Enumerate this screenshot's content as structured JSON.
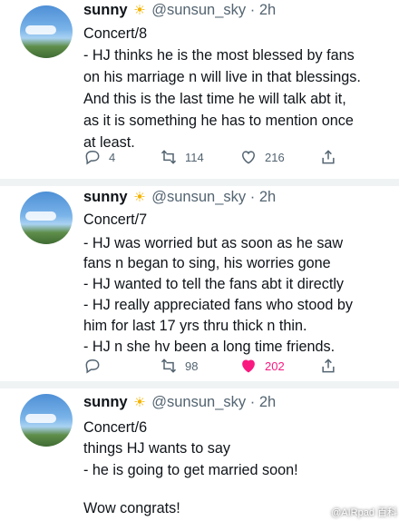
{
  "tweets": [
    {
      "name": "sunny",
      "handle": "@sunsun_sky",
      "time": "2h",
      "lines": [
        "Concert/8",
        "- HJ thinks he is the most blessed by fans",
        "on his marriage n will live in that blessings.",
        "And this is the last time he will talk abt it,",
        "as it is something he has to mention once",
        "at least."
      ],
      "replies": "4",
      "retweets": "114",
      "likes": "216",
      "liked": false
    },
    {
      "name": "sunny",
      "handle": "@sunsun_sky",
      "time": "2h",
      "lines": [
        "Concert/7",
        "- HJ was worried but as soon as he saw",
        "fans n began to sing, his worries gone",
        "- HJ wanted to tell the fans abt it directly",
        "- HJ really appreciated fans who stood by",
        "him for last 17 yrs thru thick n thin.",
        "- HJ n she hv been a long time friends."
      ],
      "replies": "",
      "retweets": "98",
      "likes": "202",
      "liked": true
    },
    {
      "name": "sunny",
      "handle": "@sunsun_sky",
      "time": "2h",
      "lines": [
        "Concert/6",
        "things HJ wants to say",
        "- he is going to get married soon!",
        "",
        "Wow congrats!"
      ]
    }
  ],
  "watermark": "@AIRpad 百科"
}
